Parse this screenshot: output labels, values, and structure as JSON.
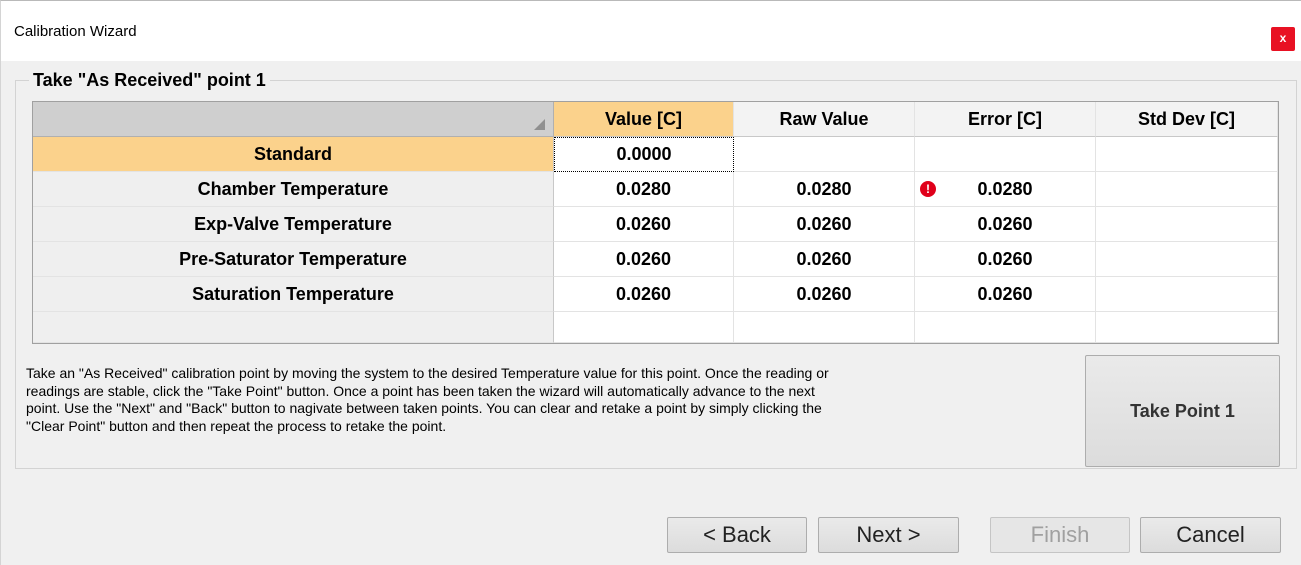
{
  "window": {
    "title": "Calibration Wizard",
    "close_label": "x"
  },
  "group": {
    "title": "Take \"As Received\" point 1"
  },
  "grid": {
    "columns": [
      "Value [C]",
      "Raw Value",
      "Error [C]",
      "Std Dev [C]"
    ],
    "rows": [
      {
        "label": "Standard",
        "value": "0.0000",
        "raw": "",
        "error": "",
        "stddev": ""
      },
      {
        "label": "Chamber Temperature",
        "value": "0.0280",
        "raw": "0.0280",
        "error": "0.0280",
        "stddev": "",
        "error_icon": "!"
      },
      {
        "label": "Exp-Valve Temperature",
        "value": "0.0260",
        "raw": "0.0260",
        "error": "0.0260",
        "stddev": ""
      },
      {
        "label": "Pre-Saturator Temperature",
        "value": "0.0260",
        "raw": "0.0260",
        "error": "0.0260",
        "stddev": ""
      },
      {
        "label": "Saturation Temperature",
        "value": "0.0260",
        "raw": "0.0260",
        "error": "0.0260",
        "stddev": ""
      }
    ]
  },
  "description": "Take an \"As Received\" calibration point by moving the system to the desired Temperature value for this point.  Once the reading or\nreadings are stable, click the \"Take Point\" button.  Once a point has been taken the wizard will automatically advance to the next\npoint.  Use the \"Next\" and \"Back\" button to nagivate between taken points.  You can clear and retake a point by simply clicking the\n\"Clear Point\" button and then repeat the process to retake the point.",
  "buttons": {
    "take_point": "Take Point 1",
    "back": "< Back",
    "next": "Next >",
    "finish": "Finish",
    "cancel": "Cancel"
  },
  "colors": {
    "selection": "#fbd28c",
    "error": "#e0001b",
    "close": "#e81123"
  }
}
